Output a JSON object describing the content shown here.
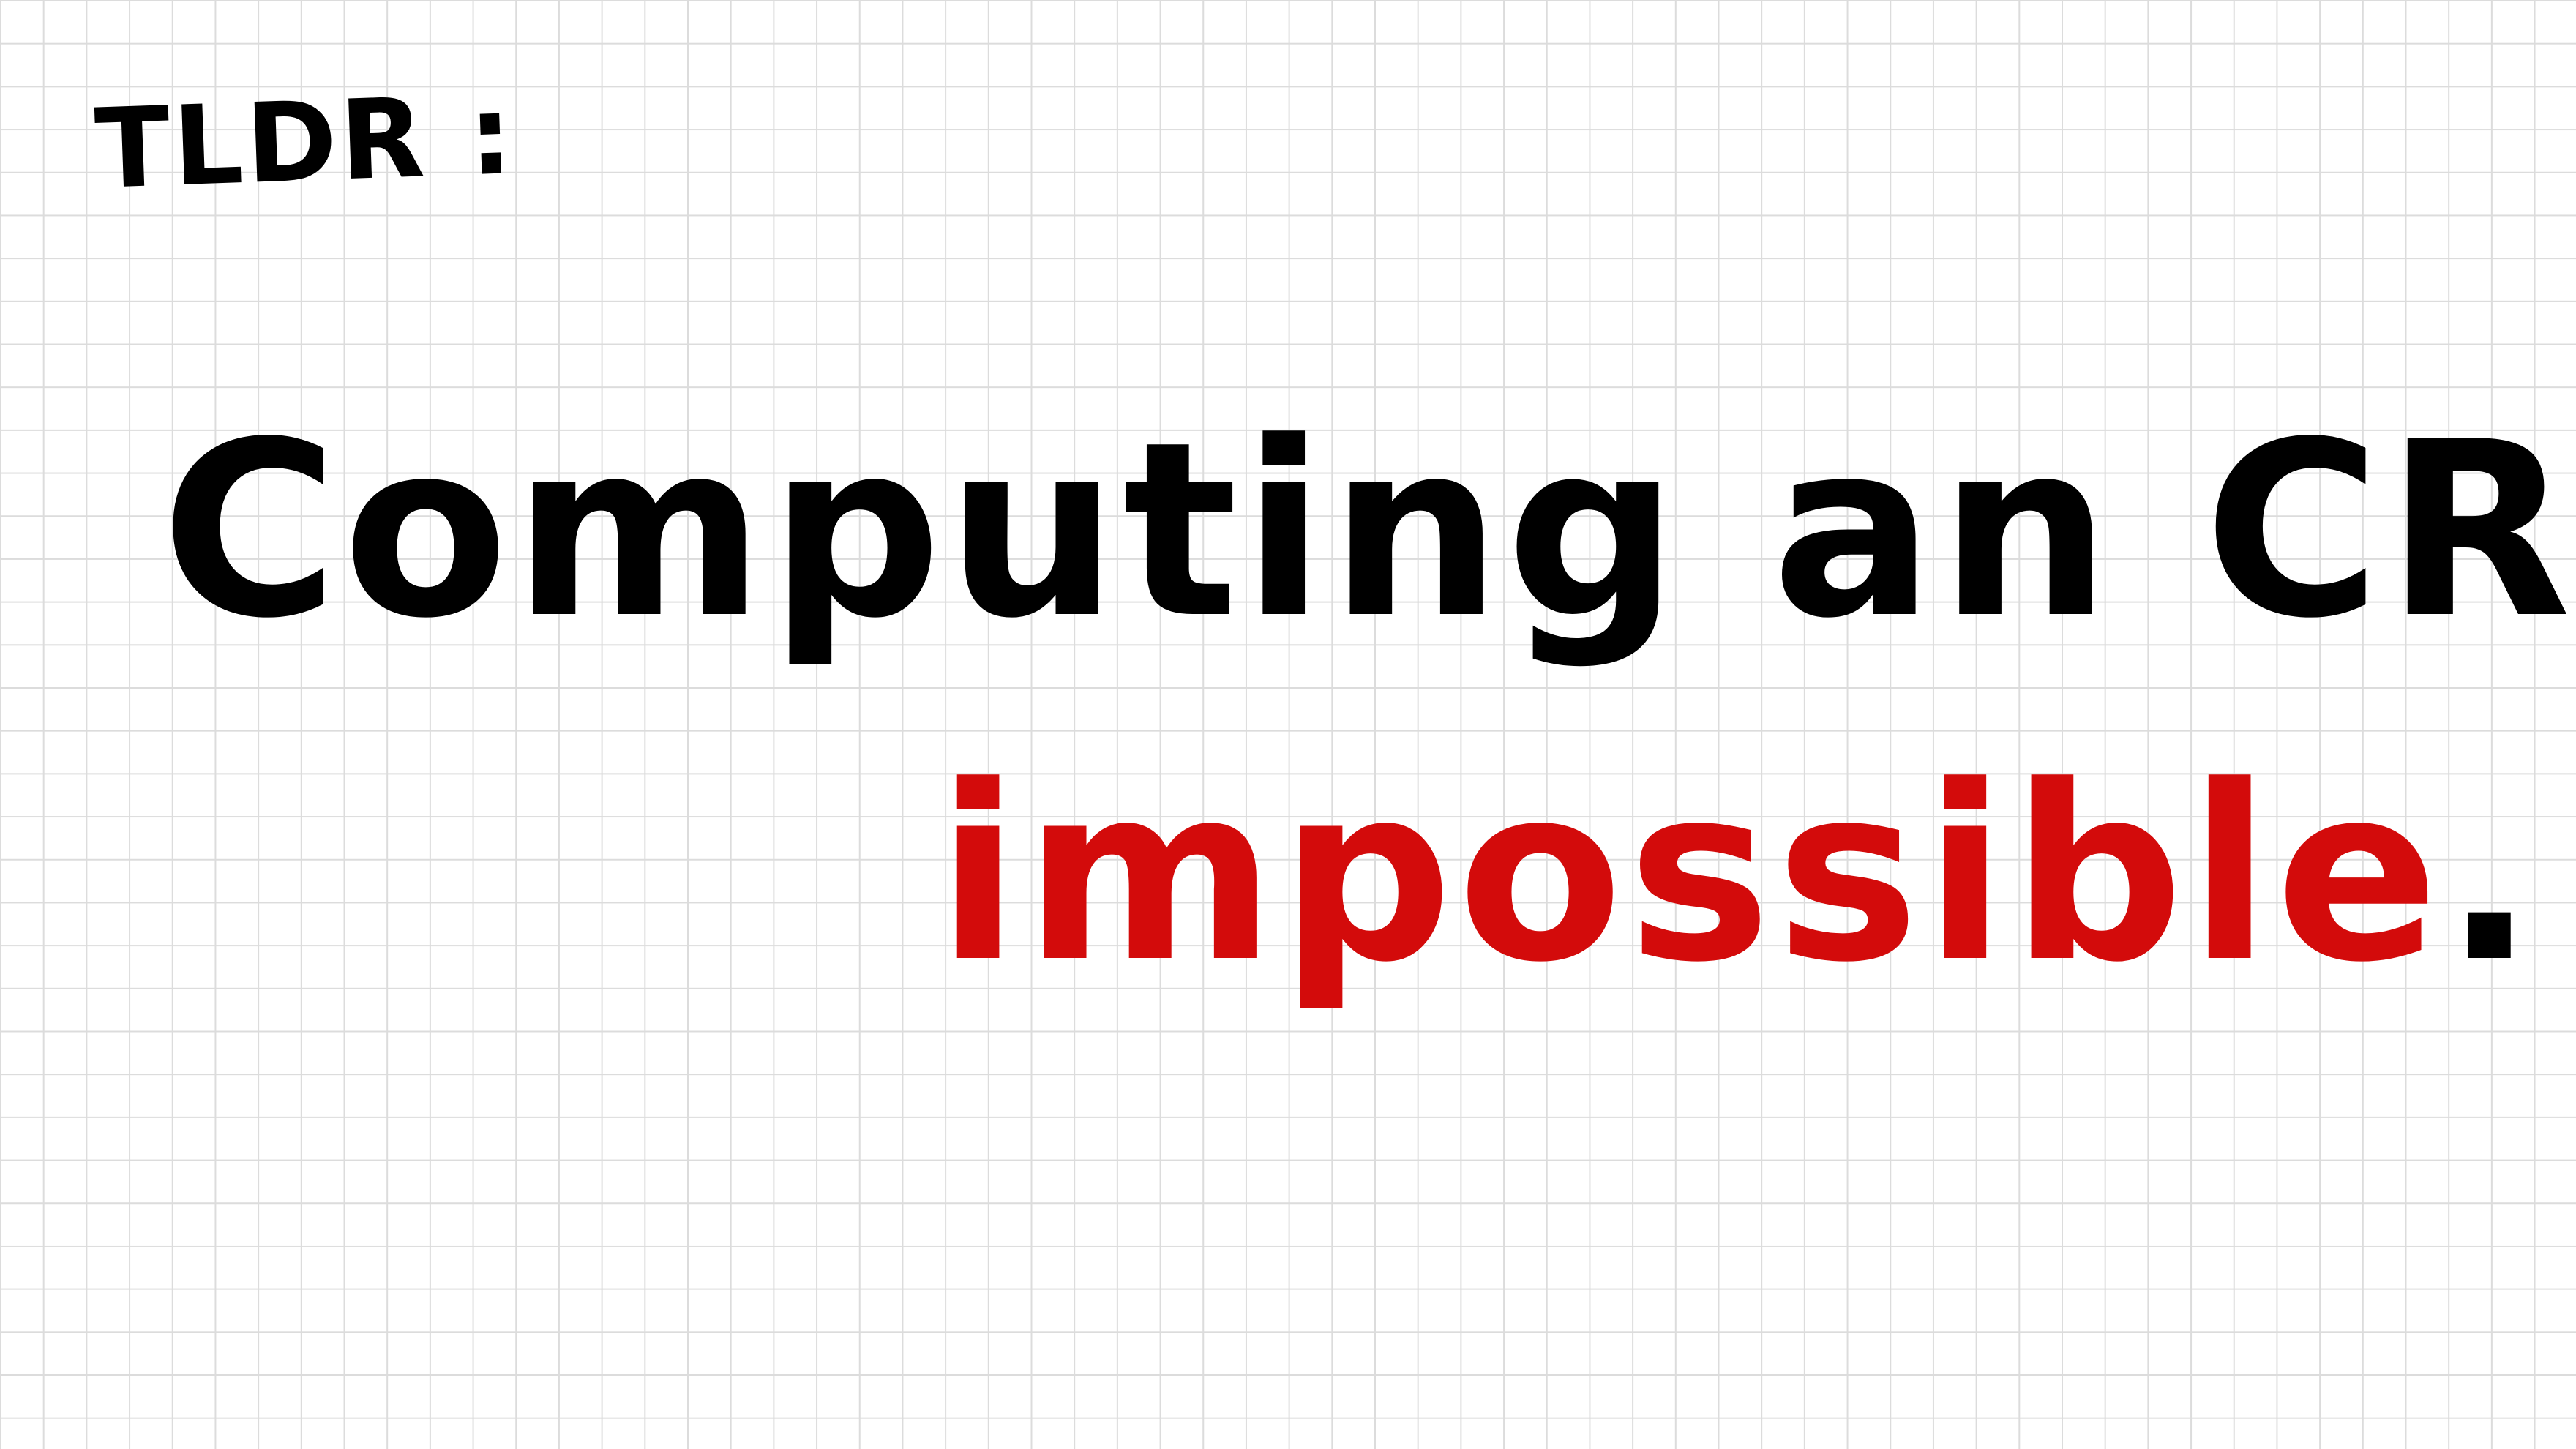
{
  "note": {
    "heading": "TLDR :",
    "sentence_part1": "Computing an CRSM is",
    "emphasis_word": "impossible",
    "end_punctuation": ".",
    "colors": {
      "ink": "#000000",
      "emphasis": "#d30b0b",
      "grid_line": "#dcdcdc",
      "paper": "#ffffff"
    }
  }
}
